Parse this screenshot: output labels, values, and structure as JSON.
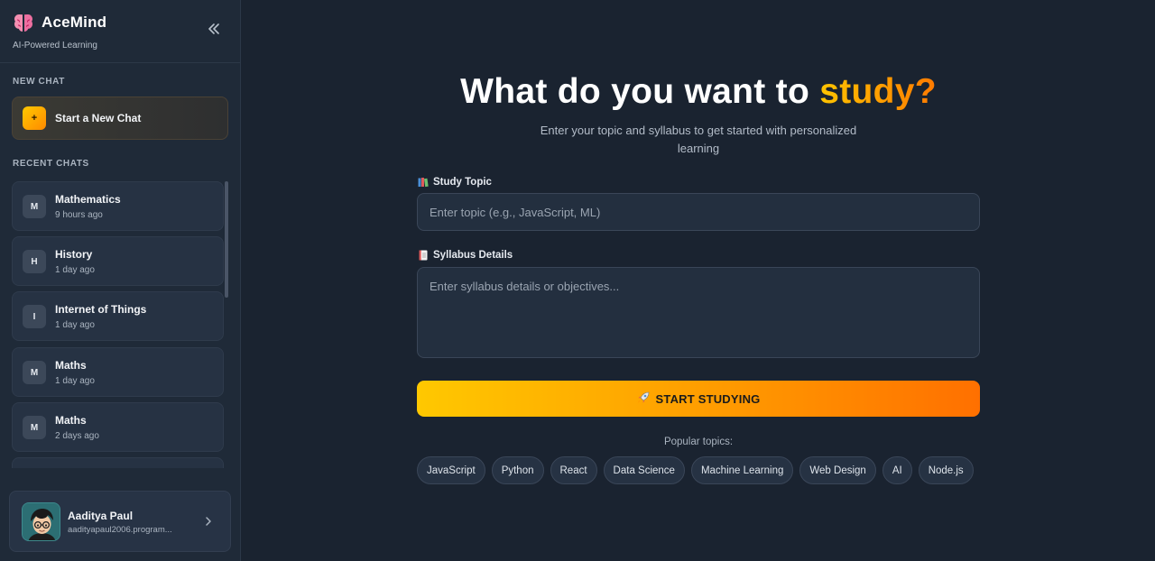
{
  "sidebar": {
    "brand": {
      "title": "AceMind",
      "subtitle": "AI-Powered Learning"
    },
    "new_chat": {
      "section_label": "NEW CHAT",
      "button_label": "Start a New Chat",
      "button_icon": "+"
    },
    "recent": {
      "section_label": "RECENT CHATS",
      "items": [
        {
          "initial": "M",
          "title": "Mathematics",
          "time": "9 hours ago"
        },
        {
          "initial": "H",
          "title": "History",
          "time": "1 day ago"
        },
        {
          "initial": "I",
          "title": "Internet of Things",
          "time": "1 day ago"
        },
        {
          "initial": "M",
          "title": "Maths",
          "time": "1 day ago"
        },
        {
          "initial": "M",
          "title": "Maths",
          "time": "2 days ago"
        }
      ]
    },
    "user": {
      "name": "Aaditya Paul",
      "email": "aadityapaul2006.program..."
    }
  },
  "main": {
    "title_prefix": "What do you want to ",
    "title_highlight": "study?",
    "subtitle": "Enter your topic and syllabus to get started with personalized learning",
    "topic": {
      "label": "Study Topic",
      "placeholder": "Enter topic (e.g., JavaScript, ML)",
      "value": ""
    },
    "syllabus": {
      "label": "Syllabus Details",
      "placeholder": "Enter syllabus details or objectives...",
      "value": ""
    },
    "start_button": "START STUDYING",
    "popular_label": "Popular topics:",
    "popular_topics": [
      "JavaScript",
      "Python",
      "React",
      "Data Science",
      "Machine Learning",
      "Web Design",
      "AI",
      "Node.js"
    ]
  },
  "colors": {
    "accent_start": "#ffc800",
    "accent_end": "#ff7000",
    "background": "#1a2330",
    "sidebar": "#1f2a38"
  }
}
